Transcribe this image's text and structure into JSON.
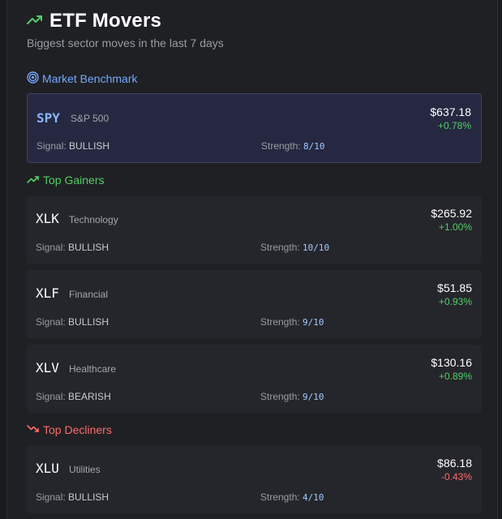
{
  "header": {
    "title": "ETF Movers",
    "subtitle": "Biggest sector moves in the last 7 days"
  },
  "colors": {
    "up": "#51cf66",
    "down": "#ff6b6b",
    "benchmark": "#74a9ff"
  },
  "sections": {
    "benchmark_label": "Market Benchmark",
    "gainers_label": "Top Gainers",
    "decliners_label": "Top Decliners"
  },
  "signal_label": "Signal:",
  "strength_label": "Strength:",
  "benchmark": {
    "symbol": "SPY",
    "name": "S&P 500",
    "price": "$637.18",
    "change": "+0.78%",
    "signal": "BULLISH",
    "strength": "8/10"
  },
  "gainers": [
    {
      "symbol": "XLK",
      "name": "Technology",
      "price": "$265.92",
      "change": "+1.00%",
      "signal": "BULLISH",
      "strength": "10/10"
    },
    {
      "symbol": "XLF",
      "name": "Financial",
      "price": "$51.85",
      "change": "+0.93%",
      "signal": "BULLISH",
      "strength": "9/10"
    },
    {
      "symbol": "XLV",
      "name": "Healthcare",
      "price": "$130.16",
      "change": "+0.89%",
      "signal": "BEARISH",
      "strength": "9/10"
    }
  ],
  "decliners": [
    {
      "symbol": "XLU",
      "name": "Utilities",
      "price": "$86.18",
      "change": "-0.43%",
      "signal": "BULLISH",
      "strength": "4/10"
    }
  ]
}
